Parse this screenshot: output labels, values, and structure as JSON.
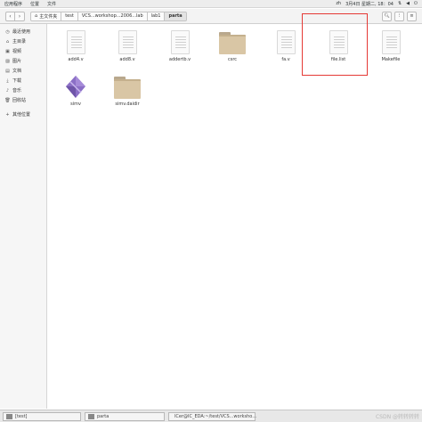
{
  "topbar": {
    "menus": [
      "应用程序",
      "位置",
      "文件"
    ],
    "lang": "zh",
    "datetime": "3月4日 星期二, 18：04",
    "icons": [
      "network-icon",
      "volume-icon",
      "power-icon"
    ]
  },
  "toolbar": {
    "back": "‹",
    "forward": "›",
    "breadcrumbs": [
      "主文件夹",
      "test",
      "VCS...workshop...2006...lab",
      "lab1",
      "parta"
    ]
  },
  "sidebar": {
    "items": [
      {
        "icon": "clock-icon",
        "label": "最近使用"
      },
      {
        "icon": "home-icon",
        "label": "主目录"
      },
      {
        "icon": "video-icon",
        "label": "视频"
      },
      {
        "icon": "image-icon",
        "label": "图片"
      },
      {
        "icon": "document-icon",
        "label": "文档"
      },
      {
        "icon": "download-icon",
        "label": "下载"
      },
      {
        "icon": "music-icon",
        "label": "音乐"
      },
      {
        "icon": "trash-icon",
        "label": "回收站"
      },
      {
        "icon": "plus-icon",
        "label": "其他位置"
      }
    ]
  },
  "files": [
    {
      "name": "add4.v",
      "kind": "doc"
    },
    {
      "name": "add8.v",
      "kind": "doc"
    },
    {
      "name": "addertb.v",
      "kind": "doc"
    },
    {
      "name": "csrc",
      "kind": "folder"
    },
    {
      "name": "fa.v",
      "kind": "doc"
    },
    {
      "name": "file.list",
      "kind": "doc"
    },
    {
      "name": "Makefile",
      "kind": "doc"
    },
    {
      "name": "simv",
      "kind": "app"
    },
    {
      "name": "simv.daidir",
      "kind": "folder"
    }
  ],
  "taskbar": {
    "items": [
      "[test]",
      "parta",
      "lCer@IC_EDA:~/test/VCS...worksho..."
    ],
    "watermark": "CSDN @转转转转"
  }
}
